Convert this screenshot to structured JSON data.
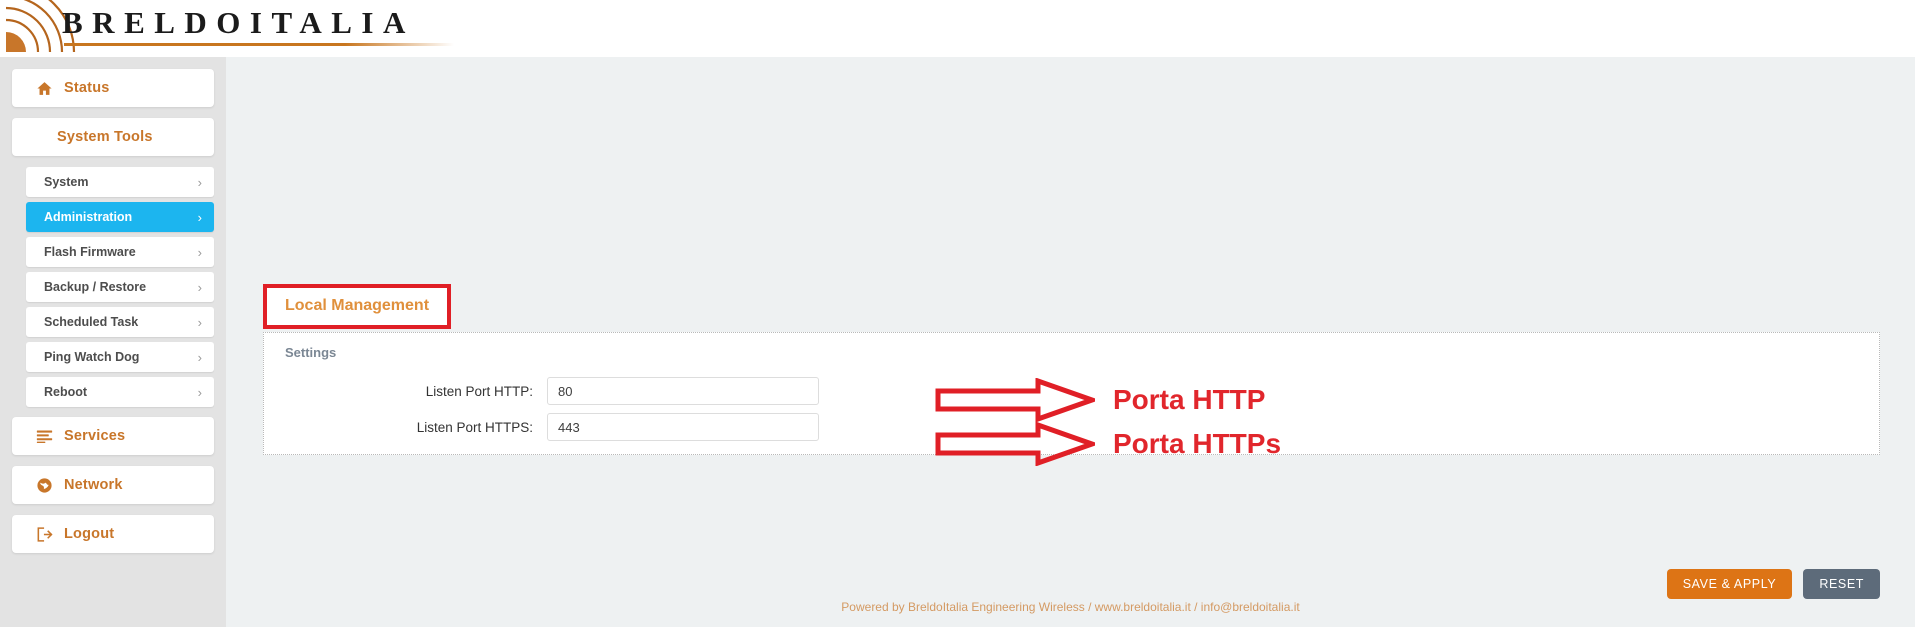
{
  "header": {
    "logo_text": "BRELDOITALIA",
    "logo_icon": "wireless-signal-arcs-icon"
  },
  "sidebar": {
    "top_items": [
      {
        "label": "Status",
        "icon": "home-icon",
        "active": false
      },
      {
        "label": "System Tools",
        "icon": null,
        "active": false
      }
    ],
    "submenu": [
      {
        "label": "System",
        "chevron": "›",
        "active": false
      },
      {
        "label": "Administration",
        "chevron": "›",
        "active": true
      },
      {
        "label": "Flash Firmware",
        "chevron": "›",
        "active": false
      },
      {
        "label": "Backup / Restore",
        "chevron": "›",
        "active": false
      },
      {
        "label": "Scheduled Task",
        "chevron": "›",
        "active": false
      },
      {
        "label": "Ping Watch Dog",
        "chevron": "›",
        "active": false
      },
      {
        "label": "Reboot",
        "chevron": "›",
        "active": false
      }
    ],
    "bottom_items": [
      {
        "label": "Services",
        "icon": "list-bars-icon"
      },
      {
        "label": "Network",
        "icon": "globe-icon"
      },
      {
        "label": "Logout",
        "icon": "sign-out-icon"
      }
    ]
  },
  "main": {
    "tab_title": "Local Management",
    "panel_legend": "Settings",
    "fields": [
      {
        "label": "Listen Port HTTP:",
        "value": "80",
        "placeholder": ""
      },
      {
        "label": "Listen Port HTTPS:",
        "value": "443",
        "placeholder": ""
      }
    ],
    "buttons": {
      "save": "SAVE & APPLY",
      "reset": "RESET"
    }
  },
  "annotations": [
    {
      "text": "Porta HTTP",
      "shape": "block-arrow-right"
    },
    {
      "text": "Porta HTTPs",
      "shape": "block-arrow-right"
    }
  ],
  "footer": {
    "text": "Powered by BreldoItalia Engineering Wireless / www.breldoitalia.it / info@breldoitalia.it"
  },
  "colors": {
    "brand_orange": "#c8762a",
    "accent_blue": "#1cb5ef",
    "annotation_red": "#e01f26",
    "save_button": "#dd7415",
    "reset_button": "#5d6b7a"
  }
}
